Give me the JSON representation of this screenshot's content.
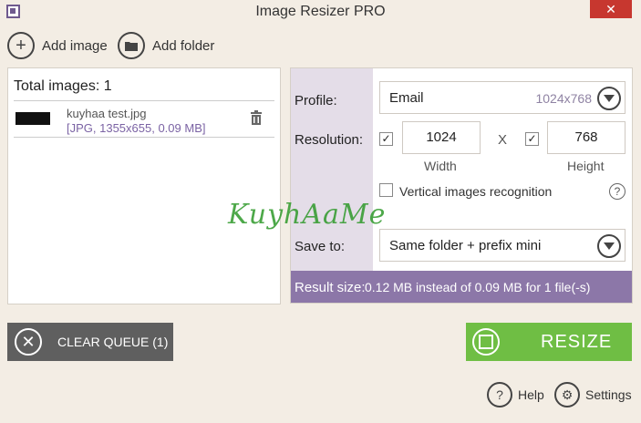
{
  "window": {
    "title": "Image Resizer PRO",
    "close_glyph": "✕"
  },
  "toolbar": {
    "add_image_label": "Add image",
    "add_folder_label": "Add folder"
  },
  "queue": {
    "total_label": "Total images: 1",
    "files": [
      {
        "name": "kuyhaa test.jpg",
        "info": "[JPG, 1355x655, 0.09 MB]"
      }
    ]
  },
  "settings": {
    "profile_label": "Profile:",
    "profile_value": "Email",
    "profile_size": "1024x768",
    "resolution_label": "Resolution:",
    "width_value": "1024",
    "height_value": "768",
    "x_sep": "X",
    "width_label": "Width",
    "height_label": "Height",
    "vertical_label": "Vertical images recognition",
    "help_glyph": "?",
    "save_to_label": "Save to:",
    "save_to_value": "Same folder + prefix mini",
    "result_label": "Result size:",
    "result_value": "0.12 MB instead of 0.09 MB for 1 file(-s)"
  },
  "watermark": "KuyhAaMe",
  "actions": {
    "clear_label": "CLEAR QUEUE (1)",
    "resize_label": "RESIZE"
  },
  "footer": {
    "help_label": "Help",
    "settings_label": "Settings"
  },
  "colors": {
    "accent_purple": "#8c77a8",
    "resize_green": "#6fbe44",
    "clear_gray": "#5f5f5f"
  }
}
